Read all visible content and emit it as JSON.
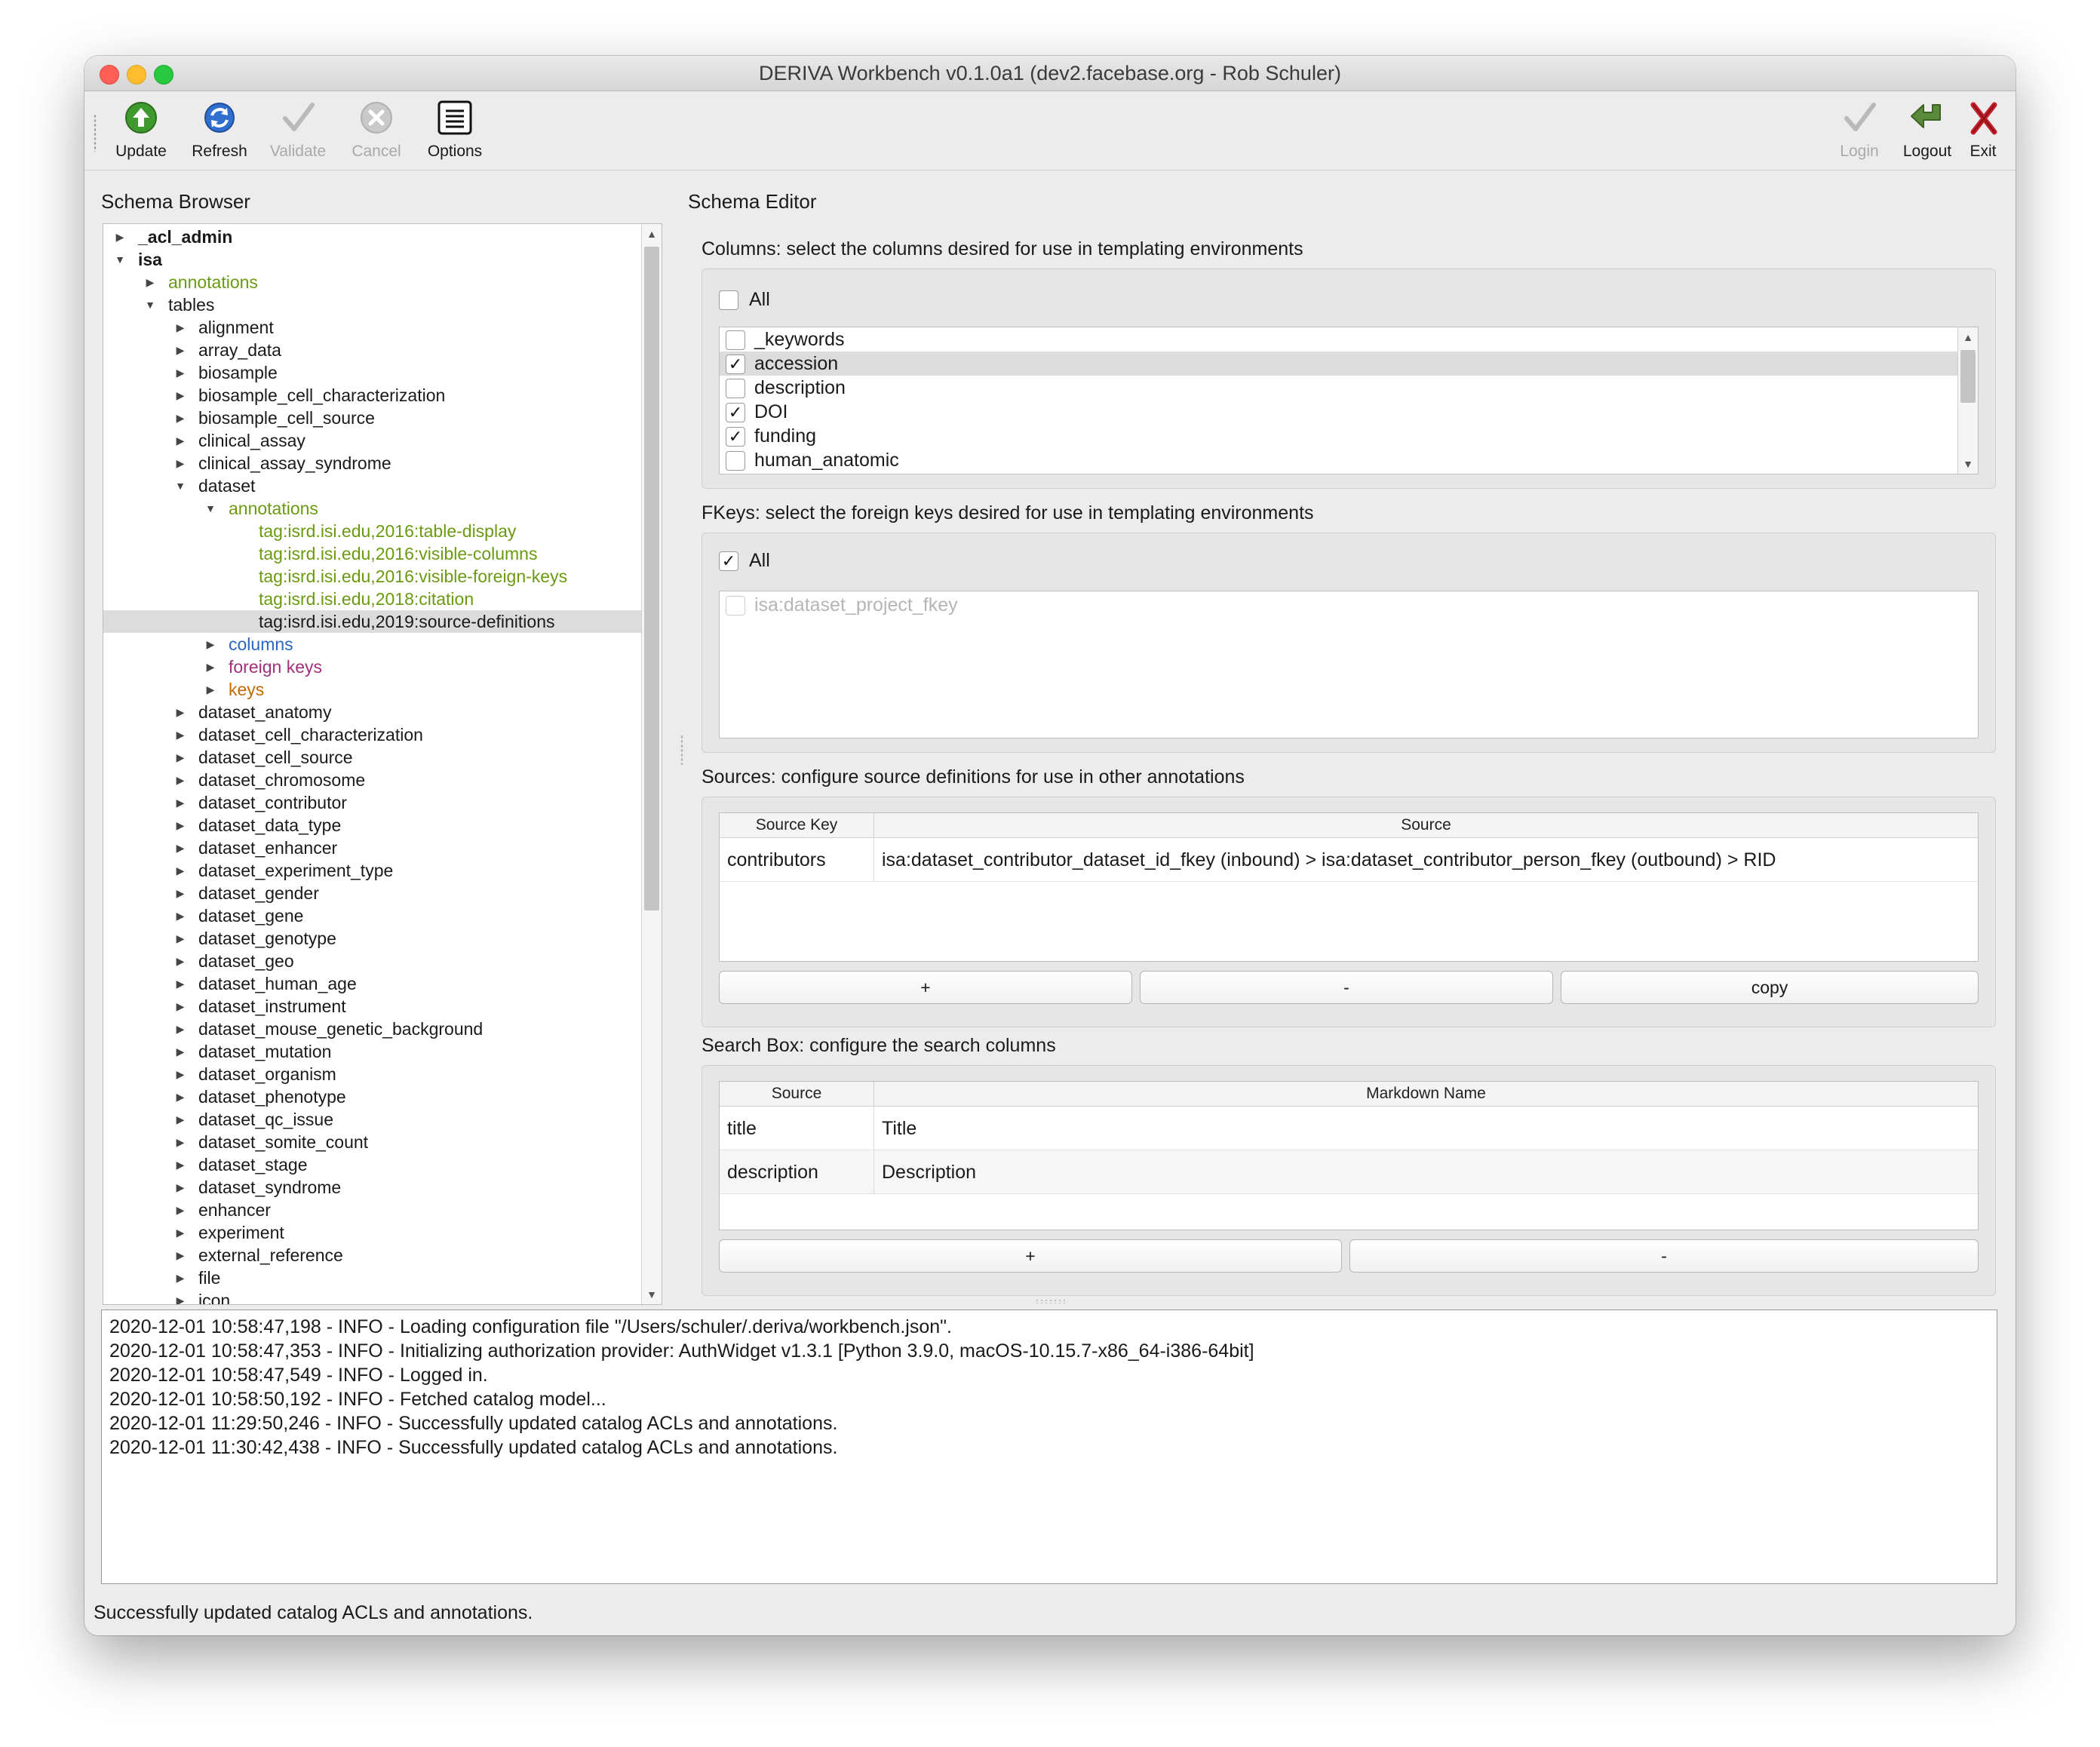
{
  "window": {
    "title": "DERIVA Workbench v0.1.0a1 (dev2.facebase.org - Rob Schuler)"
  },
  "toolbar": {
    "update": "Update",
    "refresh": "Refresh",
    "validate": "Validate",
    "cancel": "Cancel",
    "options": "Options",
    "login": "Login",
    "logout": "Logout",
    "exit": "Exit"
  },
  "browser": {
    "label": "Schema Browser",
    "items": [
      {
        "label": "_acl_admin",
        "depth": 0,
        "arrow": "right",
        "style": "bold"
      },
      {
        "label": "isa",
        "depth": 0,
        "arrow": "down",
        "style": "bold"
      },
      {
        "label": "annotations",
        "depth": 1,
        "arrow": "right",
        "style": "green"
      },
      {
        "label": "tables",
        "depth": 1,
        "arrow": "down",
        "style": ""
      },
      {
        "label": "alignment",
        "depth": 2,
        "arrow": "right",
        "style": ""
      },
      {
        "label": "array_data",
        "depth": 2,
        "arrow": "right",
        "style": ""
      },
      {
        "label": "biosample",
        "depth": 2,
        "arrow": "right",
        "style": ""
      },
      {
        "label": "biosample_cell_characterization",
        "depth": 2,
        "arrow": "right",
        "style": ""
      },
      {
        "label": "biosample_cell_source",
        "depth": 2,
        "arrow": "right",
        "style": ""
      },
      {
        "label": "clinical_assay",
        "depth": 2,
        "arrow": "right",
        "style": ""
      },
      {
        "label": "clinical_assay_syndrome",
        "depth": 2,
        "arrow": "right",
        "style": ""
      },
      {
        "label": "dataset",
        "depth": 2,
        "arrow": "down",
        "style": ""
      },
      {
        "label": "annotations",
        "depth": 3,
        "arrow": "down",
        "style": "green"
      },
      {
        "label": "tag:isrd.isi.edu,2016:table-display",
        "depth": 4,
        "arrow": "",
        "style": "green"
      },
      {
        "label": "tag:isrd.isi.edu,2016:visible-columns",
        "depth": 4,
        "arrow": "",
        "style": "green"
      },
      {
        "label": "tag:isrd.isi.edu,2016:visible-foreign-keys",
        "depth": 4,
        "arrow": "",
        "style": "green"
      },
      {
        "label": "tag:isrd.isi.edu,2018:citation",
        "depth": 4,
        "arrow": "",
        "style": "green"
      },
      {
        "label": "tag:isrd.isi.edu,2019:source-definitions",
        "depth": 4,
        "arrow": "",
        "style": "",
        "selected": true
      },
      {
        "label": "columns",
        "depth": 3,
        "arrow": "right",
        "style": "blue"
      },
      {
        "label": "foreign keys",
        "depth": 3,
        "arrow": "right",
        "style": "magenta"
      },
      {
        "label": "keys",
        "depth": 3,
        "arrow": "right",
        "style": "orange"
      },
      {
        "label": "dataset_anatomy",
        "depth": 2,
        "arrow": "right",
        "style": ""
      },
      {
        "label": "dataset_cell_characterization",
        "depth": 2,
        "arrow": "right",
        "style": ""
      },
      {
        "label": "dataset_cell_source",
        "depth": 2,
        "arrow": "right",
        "style": ""
      },
      {
        "label": "dataset_chromosome",
        "depth": 2,
        "arrow": "right",
        "style": ""
      },
      {
        "label": "dataset_contributor",
        "depth": 2,
        "arrow": "right",
        "style": ""
      },
      {
        "label": "dataset_data_type",
        "depth": 2,
        "arrow": "right",
        "style": ""
      },
      {
        "label": "dataset_enhancer",
        "depth": 2,
        "arrow": "right",
        "style": ""
      },
      {
        "label": "dataset_experiment_type",
        "depth": 2,
        "arrow": "right",
        "style": ""
      },
      {
        "label": "dataset_gender",
        "depth": 2,
        "arrow": "right",
        "style": ""
      },
      {
        "label": "dataset_gene",
        "depth": 2,
        "arrow": "right",
        "style": ""
      },
      {
        "label": "dataset_genotype",
        "depth": 2,
        "arrow": "right",
        "style": ""
      },
      {
        "label": "dataset_geo",
        "depth": 2,
        "arrow": "right",
        "style": ""
      },
      {
        "label": "dataset_human_age",
        "depth": 2,
        "arrow": "right",
        "style": ""
      },
      {
        "label": "dataset_instrument",
        "depth": 2,
        "arrow": "right",
        "style": ""
      },
      {
        "label": "dataset_mouse_genetic_background",
        "depth": 2,
        "arrow": "right",
        "style": ""
      },
      {
        "label": "dataset_mutation",
        "depth": 2,
        "arrow": "right",
        "style": ""
      },
      {
        "label": "dataset_organism",
        "depth": 2,
        "arrow": "right",
        "style": ""
      },
      {
        "label": "dataset_phenotype",
        "depth": 2,
        "arrow": "right",
        "style": ""
      },
      {
        "label": "dataset_qc_issue",
        "depth": 2,
        "arrow": "right",
        "style": ""
      },
      {
        "label": "dataset_somite_count",
        "depth": 2,
        "arrow": "right",
        "style": ""
      },
      {
        "label": "dataset_stage",
        "depth": 2,
        "arrow": "right",
        "style": ""
      },
      {
        "label": "dataset_syndrome",
        "depth": 2,
        "arrow": "right",
        "style": ""
      },
      {
        "label": "enhancer",
        "depth": 2,
        "arrow": "right",
        "style": ""
      },
      {
        "label": "experiment",
        "depth": 2,
        "arrow": "right",
        "style": ""
      },
      {
        "label": "external_reference",
        "depth": 2,
        "arrow": "right",
        "style": ""
      },
      {
        "label": "file",
        "depth": 2,
        "arrow": "right",
        "style": ""
      },
      {
        "label": "icon",
        "depth": 2,
        "arrow": "right",
        "style": ""
      }
    ]
  },
  "editor": {
    "label": "Schema Editor",
    "columns": {
      "label": "Columns: select the columns desired for use in templating environments",
      "all_label": "All",
      "all_checked": false,
      "items": [
        {
          "label": "_keywords",
          "checked": false,
          "selected": false
        },
        {
          "label": "accession",
          "checked": true,
          "selected": true
        },
        {
          "label": "description",
          "checked": false,
          "selected": false
        },
        {
          "label": "DOI",
          "checked": true,
          "selected": false
        },
        {
          "label": "funding",
          "checked": true,
          "selected": false
        },
        {
          "label": "human_anatomic",
          "checked": false,
          "selected": false
        }
      ]
    },
    "fkeys": {
      "label": "FKeys: select the foreign keys desired for use in templating environments",
      "all_label": "All",
      "all_checked": true,
      "items": [
        {
          "label": "isa:dataset_project_fkey",
          "checked": false,
          "disabled": true
        }
      ]
    },
    "sources": {
      "label": "Sources: configure source definitions for use in other annotations",
      "headers": [
        "Source Key",
        "Source"
      ],
      "rows": [
        [
          "contributors",
          "isa:dataset_contributor_dataset_id_fkey (inbound) > isa:dataset_contributor_person_fkey (outbound) > RID"
        ]
      ],
      "add_label": "+",
      "remove_label": "-",
      "copy_label": "copy"
    },
    "search": {
      "label": "Search Box: configure the search columns",
      "headers": [
        "Source",
        "Markdown Name"
      ],
      "rows": [
        [
          "title",
          "Title"
        ],
        [
          "description",
          "Description"
        ]
      ],
      "add_label": "+",
      "remove_label": "-"
    }
  },
  "log": {
    "lines": [
      "2020-12-01 10:58:47,198 - INFO - Loading configuration file \"/Users/schuler/.deriva/workbench.json\".",
      "2020-12-01 10:58:47,353 - INFO - Initializing authorization provider: AuthWidget v1.3.1 [Python 3.9.0, macOS-10.15.7-x86_64-i386-64bit]",
      "2020-12-01 10:58:47,549 - INFO - Logged in.",
      "2020-12-01 10:58:50,192 - INFO - Fetched catalog model...",
      "2020-12-01 11:29:50,246 - INFO - Successfully updated catalog ACLs and annotations.",
      "2020-12-01 11:30:42,438 - INFO - Successfully updated catalog ACLs and annotations."
    ]
  },
  "status": {
    "text": "Successfully updated catalog ACLs and annotations."
  }
}
